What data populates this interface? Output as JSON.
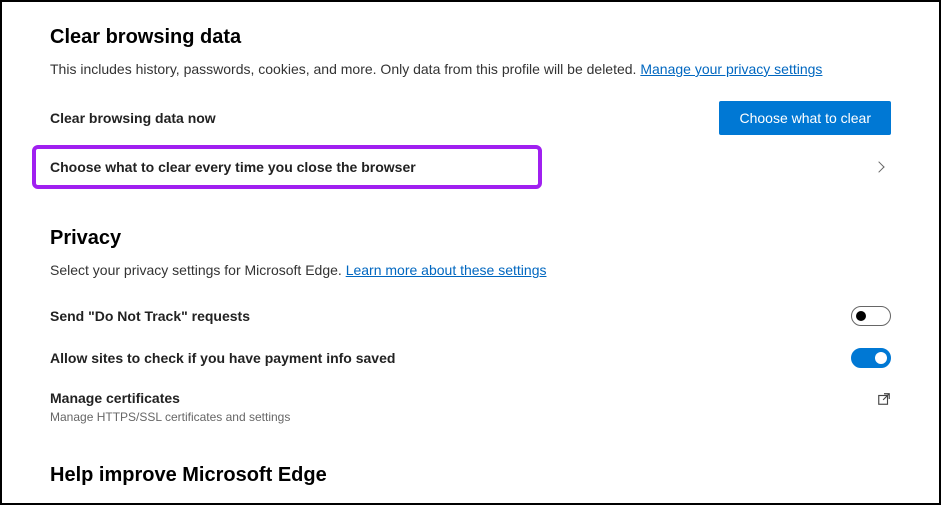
{
  "clearData": {
    "title": "Clear browsing data",
    "description": "This includes history, passwords, cookies, and more. Only data from this profile will be deleted. ",
    "privacyLink": "Manage your privacy settings",
    "nowLabel": "Clear browsing data now",
    "buttonLabel": "Choose what to clear",
    "everyTimeLabel": "Choose what to clear every time you close the browser"
  },
  "privacy": {
    "title": "Privacy",
    "description": "Select your privacy settings for Microsoft Edge. ",
    "learnMoreLink": "Learn more about these settings",
    "doNotTrack": "Send \"Do Not Track\" requests",
    "paymentInfo": "Allow sites to check if you have payment info saved",
    "certTitle": "Manage certificates",
    "certSub": "Manage HTTPS/SSL certificates and settings"
  },
  "help": {
    "title": "Help improve Microsoft Edge"
  }
}
